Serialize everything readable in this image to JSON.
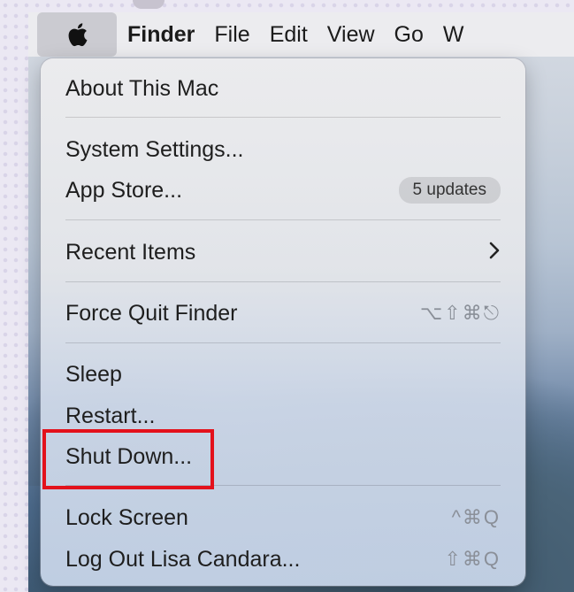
{
  "menubar": {
    "apple_label": "",
    "items": [
      "Finder",
      "File",
      "Edit",
      "View",
      "Go",
      "W"
    ]
  },
  "menu": {
    "about": "About This Mac",
    "system_settings": "System Settings...",
    "app_store": "App Store...",
    "app_store_badge": "5 updates",
    "recent_items": "Recent Items",
    "force_quit": "Force Quit Finder",
    "force_quit_shortcut": "⌥⇧⌘⎋",
    "sleep": "Sleep",
    "restart": "Restart...",
    "shut_down": "Shut Down...",
    "lock_screen": "Lock Screen",
    "lock_screen_shortcut": "^⌘Q",
    "log_out": "Log Out Lisa Candara...",
    "log_out_shortcut": "⇧⌘Q"
  },
  "colors": {
    "highlight_border": "#e3111b",
    "menu_text": "#1e1e1e",
    "shortcut_text": "#8a8f98"
  },
  "icons": {
    "apple": "apple-logo-icon",
    "chevron": "chevron-right-icon"
  }
}
